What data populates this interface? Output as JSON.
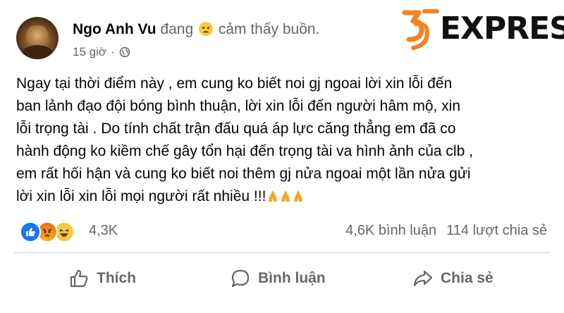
{
  "post": {
    "author_name": "Ngo Anh Vu",
    "feeling_prefix": "đang",
    "feeling_text": "cảm thấy buồn.",
    "time": "15 giờ",
    "separator": "·",
    "audience_icon": "globe-icon",
    "text_lines": [
      "Ngay tại thời điểm này , em cung ko biết noi gj ngoai lời xin lỗi đến",
      "ban lảnh đạo đội bóng bình thuận, lời xin lỗi đến người hâm mộ, xin",
      "lỗi trọng tài . Do tính chất trận đấu quá áp lực căng thẳng em đã co",
      "hành động ko kiềm chế gây tổn hại đến trọng tài va hình ảnh của clb ,",
      "em rất hối hận và cung ko biết noi thêm gj nửa ngoai một lần nửa gửi",
      "lời xin lỗi xin lỗi mọi người rất nhiều !!!"
    ]
  },
  "watermark": {
    "brand": "EXPRESS",
    "brand_color": "#f5821f"
  },
  "reactions": {
    "icons": [
      "like-reaction-icon",
      "angry-reaction-icon",
      "haha-reaction-icon"
    ],
    "count": "4,3K"
  },
  "stats": {
    "comments": "4,6K bình luận",
    "shares": "114 lượt chia sẻ"
  },
  "actions": {
    "like": "Thích",
    "comment": "Bình luận",
    "share": "Chia sẻ"
  },
  "colors": {
    "text": "#050505",
    "secondary": "#65676b",
    "like_blue": "#1877f2",
    "divider": "#ced0d4"
  }
}
